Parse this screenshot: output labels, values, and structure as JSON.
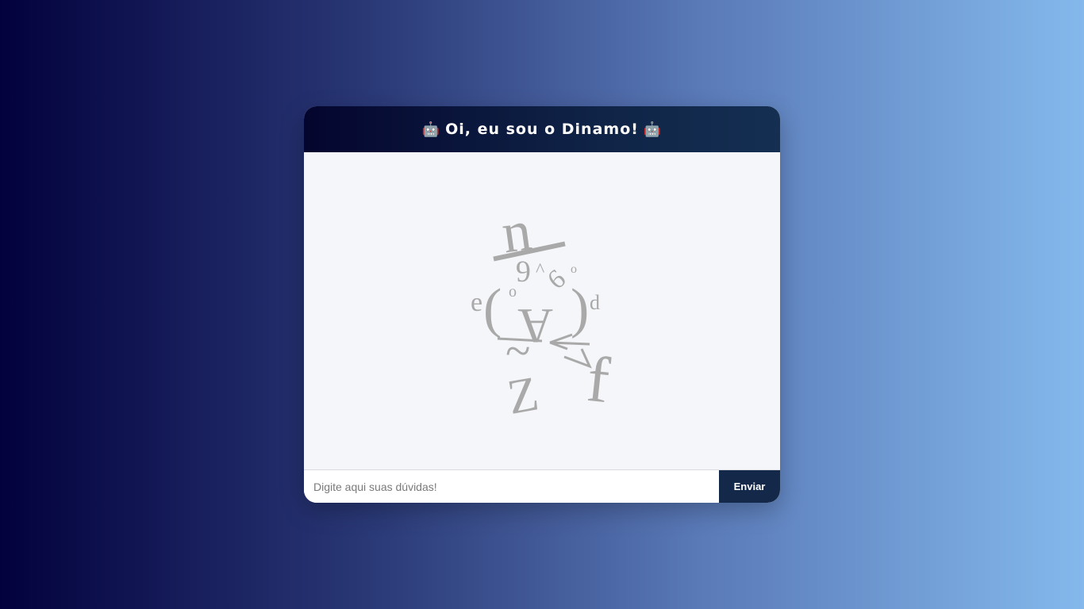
{
  "chat": {
    "header": {
      "left_icon": "robot-emoji",
      "title": "Oi, eu sou o Dinamo!",
      "right_icon": "robot-emoji",
      "icon_glyph": "🤖"
    },
    "mascot": {
      "icon": "typographic-robot-mascot",
      "glyphs": [
        "n",
        "6",
        "^",
        "6",
        "o",
        "o",
        "e",
        "(",
        ")",
        "d",
        "A",
        "Z",
        "f",
        "~"
      ]
    },
    "input": {
      "placeholder": "Digite aqui suas dúvidas!",
      "value": ""
    },
    "send_label": "Enviar"
  },
  "colors": {
    "header_bg": "#0f2346",
    "send_bg": "#14294a",
    "body_bg": "#f5f6f9",
    "glyph_color": "#a9a9a9"
  }
}
